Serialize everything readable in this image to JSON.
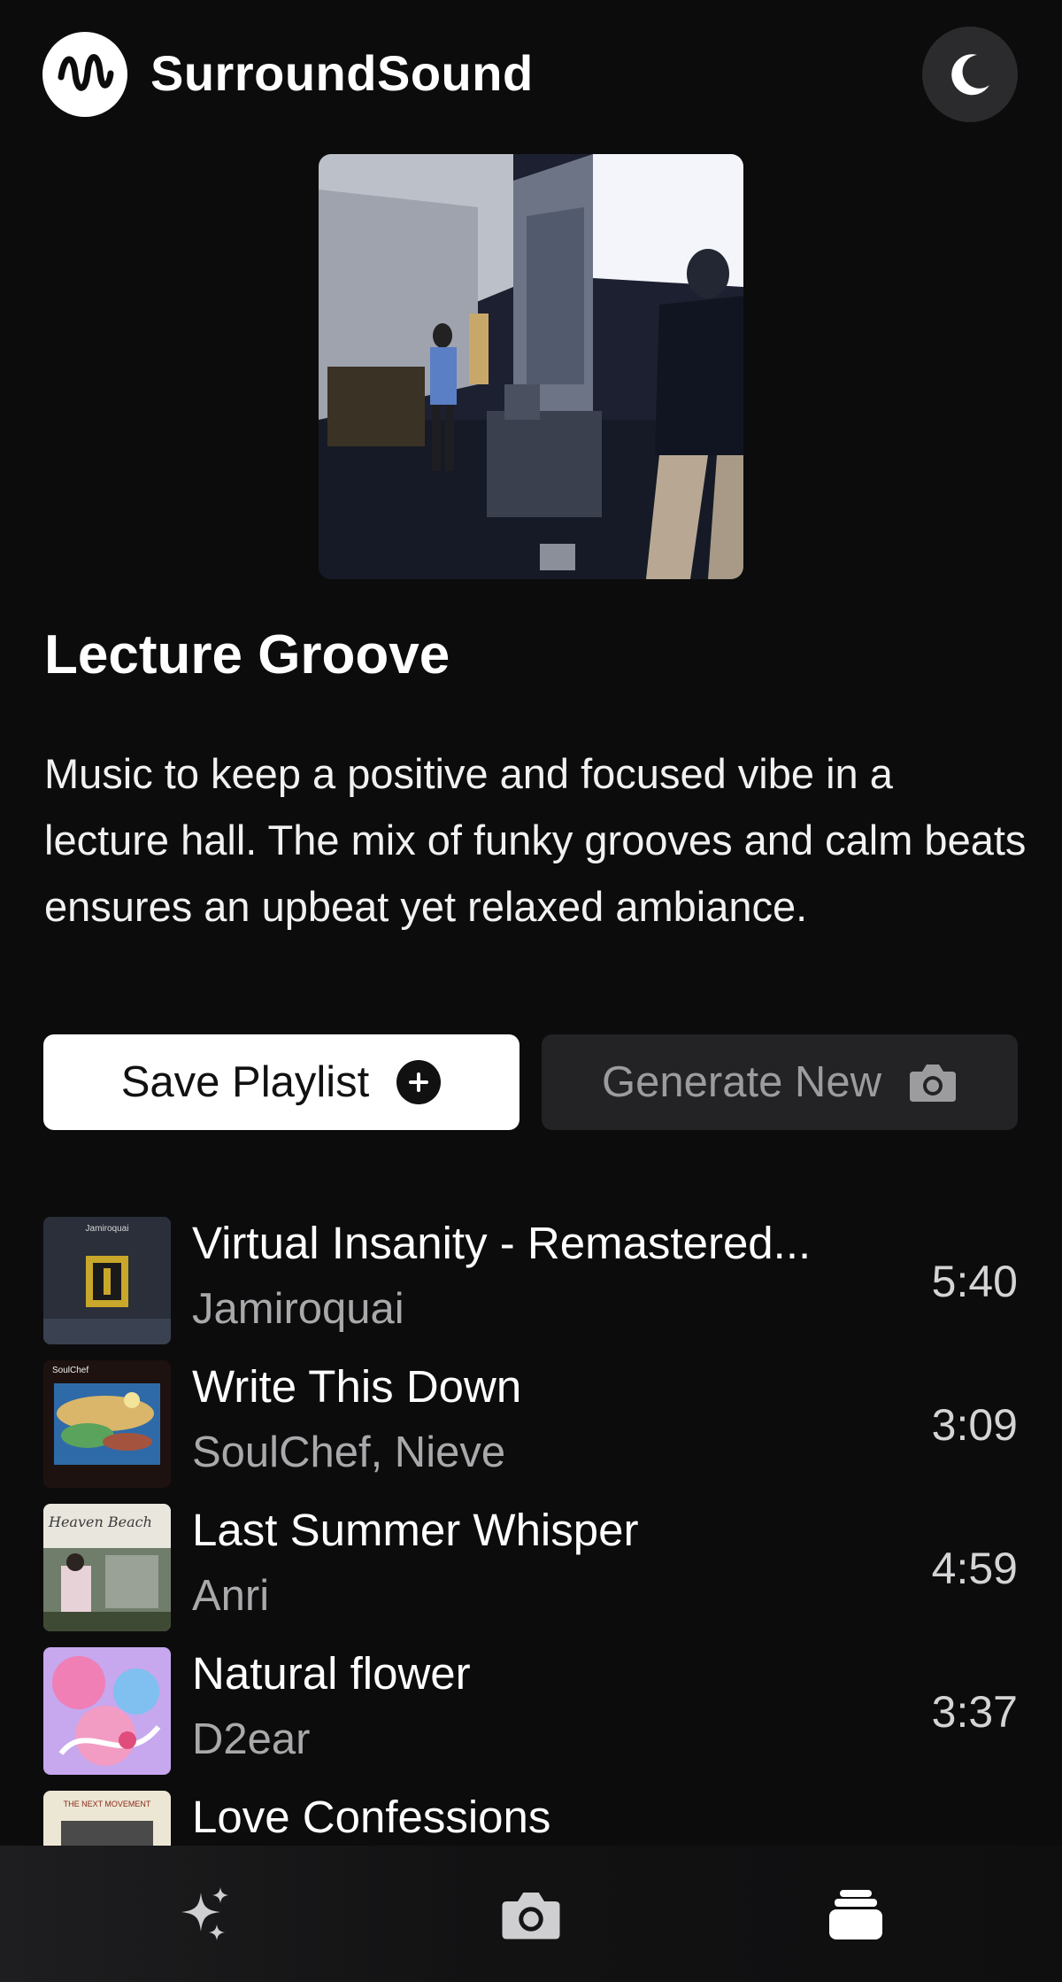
{
  "app": {
    "title": "SurroundSound"
  },
  "playlist": {
    "title": "Lecture Groove",
    "description": "Music to keep a positive and focused vibe in a lecture hall. The mix of funky grooves and calm beats ensures an upbeat yet relaxed ambiance."
  },
  "actions": {
    "save_label": "Save Playlist",
    "save_icon": "plus-circle-icon",
    "generate_label": "Generate New",
    "generate_icon": "camera-icon"
  },
  "tracks": [
    {
      "title": "Virtual Insanity - Remastered...",
      "artist": "Jamiroquai",
      "duration": "5:40"
    },
    {
      "title": "Write This Down",
      "artist": "SoulChef, Nieve",
      "duration": "3:09"
    },
    {
      "title": "Last Summer Whisper",
      "artist": "Anri",
      "duration": "4:59"
    },
    {
      "title": "Natural flower",
      "artist": "D2ear",
      "duration": "3:37"
    },
    {
      "title": "Love Confessions",
      "artist": "",
      "duration": ""
    }
  ],
  "album_art_text": [
    "Jamiroquai",
    "SoulChef",
    "Heaven Beach",
    "THE NEXT MOVEMENT"
  ],
  "nav": [
    {
      "icon": "sparkles-icon"
    },
    {
      "icon": "camera-icon"
    },
    {
      "icon": "library-stack-icon"
    }
  ],
  "colors": {
    "background": "#0c0c0d",
    "primary_button": "#ffffff",
    "secondary_button": "#232325",
    "muted_text": "#a9a9ac"
  }
}
